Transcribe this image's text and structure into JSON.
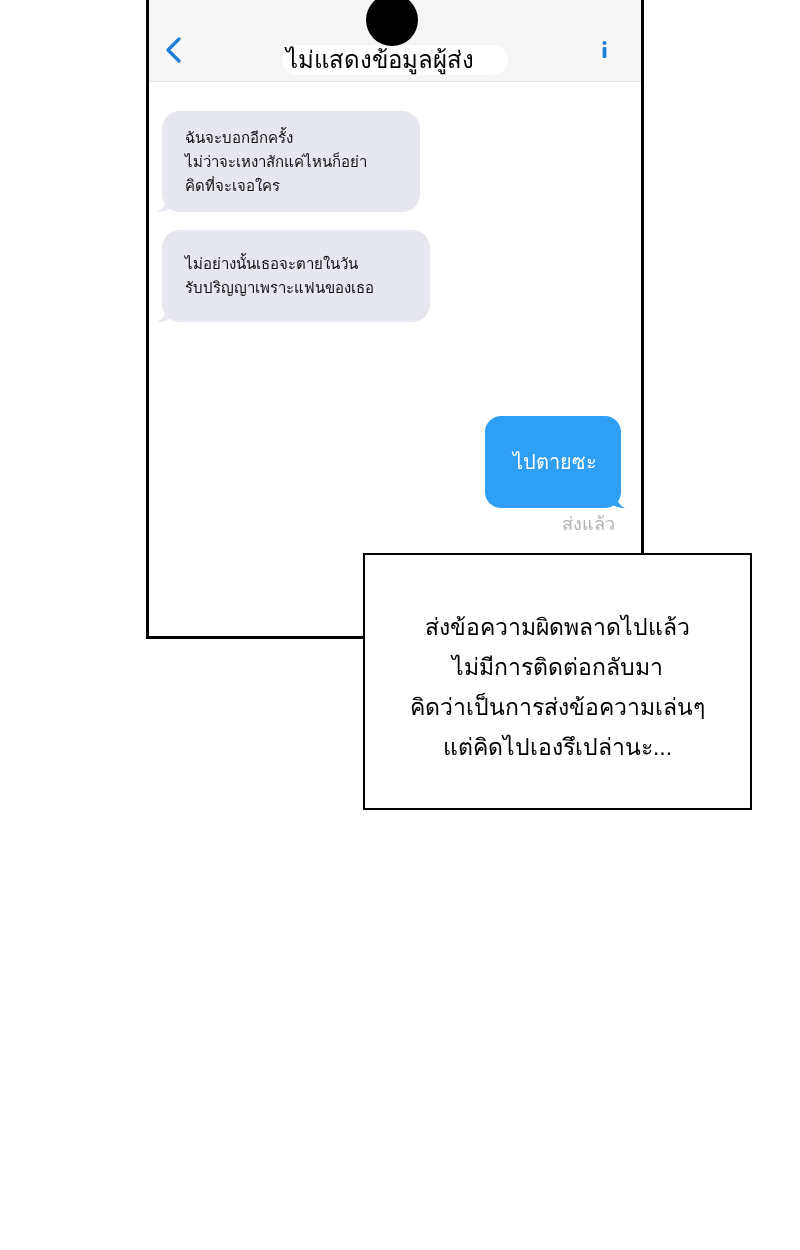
{
  "header": {
    "title": "ไม่แสดงข้อมูลผู้ส่ง"
  },
  "messages": [
    {
      "kind": "received",
      "text": "ฉันจะบอกอีกครั้ง\nไม่ว่าจะเหงาสักแค่ไหนก็อย่า\nคิดที่จะเจอใคร"
    },
    {
      "kind": "received",
      "text": "ไม่อย่างนั้นเธอจะตายในวัน\nรับปริญญาเพราะแฟนของเธอ"
    },
    {
      "kind": "sent",
      "text": "ไปตายซะ"
    }
  ],
  "delivery_status": "ส่งแล้ว",
  "caption": {
    "text": "ส่งข้อความผิดพลาดไปแล้ว\nไม่มีการติดต่อกลับมา\nคิดว่าเป็นการส่งข้อความเล่นๆ\nแต่คิดไปเองรึเปล่านะ..."
  }
}
